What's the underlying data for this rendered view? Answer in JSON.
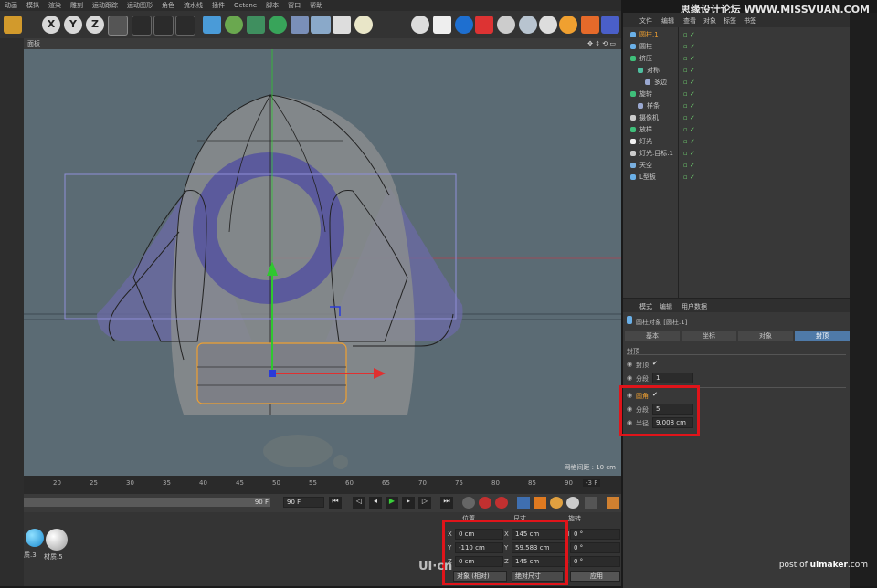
{
  "menu": [
    "动画",
    "模拟",
    "渲染",
    "雕刻",
    "运动跟踪",
    "运动图形",
    "角色",
    "流水线",
    "插件",
    "Octane",
    "脚本",
    "窗口",
    "帮助"
  ],
  "watermark_top": "思缘设计论坛 WWW.MISSVUAN.COM",
  "toolbar": {
    "axis_labels": [
      "X",
      "Y",
      "Z"
    ]
  },
  "viewport": {
    "title": "面板",
    "grid_label": "网格间距 : 10 cm"
  },
  "timeline": {
    "ticks": [
      "20",
      "25",
      "30",
      "35",
      "40",
      "45",
      "50",
      "55",
      "60",
      "65",
      "70",
      "75",
      "80",
      "85",
      "90"
    ],
    "frame_display": "-3 F",
    "end_frame": "90 F",
    "end_frame_field": "90 F"
  },
  "object_manager": {
    "menu": [
      "文件",
      "编辑",
      "查看",
      "对象",
      "标签",
      "书签"
    ],
    "objects": [
      {
        "name": "圆柱.1",
        "indent": 0,
        "highlight": true
      },
      {
        "name": "圆柱",
        "indent": 0,
        "highlight": false
      },
      {
        "name": "挤压",
        "indent": 0,
        "highlight": false
      },
      {
        "name": "对称",
        "indent": 1,
        "highlight": false
      },
      {
        "name": "多边",
        "indent": 2,
        "highlight": false
      },
      {
        "name": "旋转",
        "indent": 0,
        "highlight": false
      },
      {
        "name": "样条",
        "indent": 1,
        "highlight": false
      },
      {
        "name": "摄像机",
        "indent": 0,
        "highlight": false
      },
      {
        "name": "放样",
        "indent": 0,
        "highlight": false
      },
      {
        "name": "灯光",
        "indent": 0,
        "highlight": false
      },
      {
        "name": "灯光.目标.1",
        "indent": 0,
        "highlight": false
      },
      {
        "name": "天空",
        "indent": 0,
        "highlight": false
      },
      {
        "name": "L型板",
        "indent": 0,
        "highlight": false
      }
    ]
  },
  "attributes": {
    "menu": [
      "模式",
      "编辑",
      "用户数据"
    ],
    "object_title": "圆柱对象 [圆柱.1]",
    "tabs": [
      "基本",
      "坐标",
      "对象",
      "封顶"
    ],
    "active_tab": "封顶",
    "section": "封顶",
    "cap_label": "封顶",
    "cap_segments_label": "分段",
    "cap_segments_value": "1",
    "fillet_label": "圆角",
    "fillet_segments_label": "分段",
    "fillet_segments_value": "5",
    "radius_label": "半径",
    "radius_value": "9.008 cm"
  },
  "coordinates": {
    "headers": [
      "位置",
      "尺寸",
      "旋转"
    ],
    "position": [
      {
        "axis": "X",
        "value": "0 cm"
      },
      {
        "axis": "Y",
        "value": "-110 cm"
      },
      {
        "axis": "Z",
        "value": "0 cm"
      }
    ],
    "size": [
      {
        "axis": "X",
        "value": "145 cm"
      },
      {
        "axis": "Y",
        "value": "59.583 cm"
      },
      {
        "axis": "Z",
        "value": "145 cm"
      }
    ],
    "rotation": [
      {
        "axis": "H",
        "value": "0 °"
      },
      {
        "axis": "P",
        "value": "0 °"
      },
      {
        "axis": "B",
        "value": "0 °"
      }
    ],
    "mode_select": "对象 (相对)",
    "size_select": "绝对尺寸",
    "apply": "应用"
  },
  "materials": [
    {
      "name": "质.3"
    },
    {
      "name": "材质.5"
    }
  ],
  "bottom_watermark": {
    "prefix": "post of ",
    "site": "uimaker",
    "suffix": ".com"
  },
  "center_watermark": "UI·cn",
  "colors": {
    "highlight_red": "#e0141a",
    "viewport_bg": "#5b6b74",
    "accent_orange": "#f0a030",
    "selected_tab": "#4f7aa8"
  }
}
